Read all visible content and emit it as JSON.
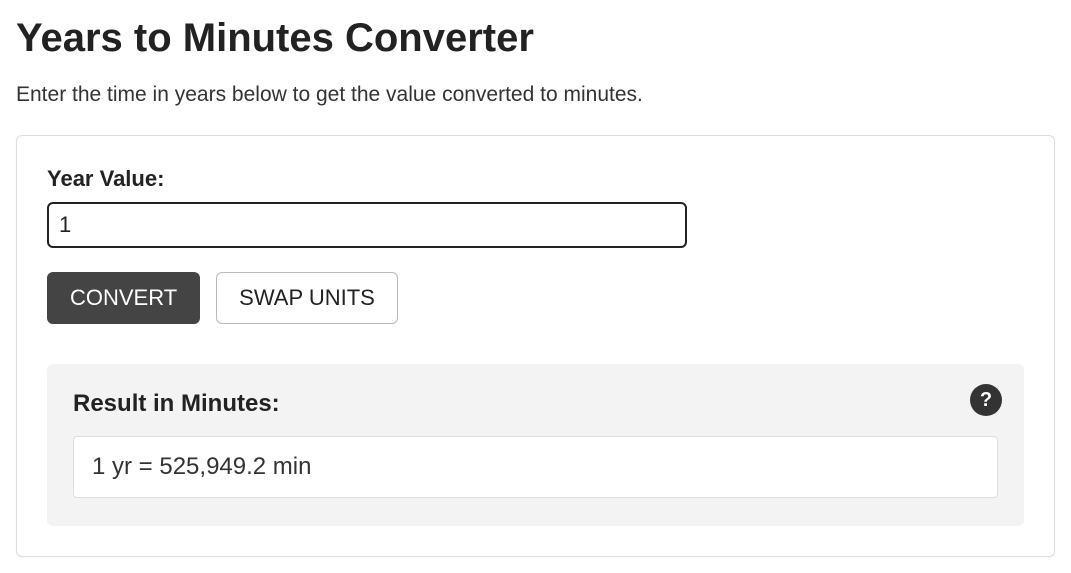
{
  "title": "Years to Minutes Converter",
  "description": "Enter the time in years below to get the value converted to minutes.",
  "form": {
    "input_label": "Year Value:",
    "input_value": "1",
    "convert_button": "CONVERT",
    "swap_button": "SWAP UNITS"
  },
  "result": {
    "label": "Result in Minutes:",
    "value": "1 yr = 525,949.2 min",
    "help_icon": "?"
  }
}
